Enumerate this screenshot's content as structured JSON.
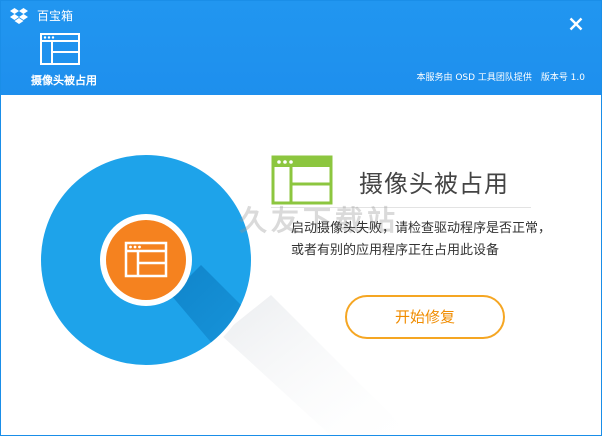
{
  "header": {
    "app_name": "百宝箱",
    "tab_label": "摄像头被占用",
    "provider": "本服务由 OSD 工具团队提供",
    "version": "版本号 1.0",
    "close_symbol": "✕"
  },
  "main": {
    "error_title": "摄像头被占用",
    "description_line1": "启动摄像头失败，请检查驱动程序是否正常，",
    "description_line2": "或者有别的应用程序正在占用此设备",
    "repair_button": "开始修复",
    "watermark": "久友下载站"
  },
  "colors": {
    "header_blue": "#1e8fed",
    "circle_blue": "#1ea3ea",
    "accent_orange": "#f5821f",
    "icon_green": "#8cc63f",
    "button_border": "#f5a623"
  },
  "icons": {
    "app_logo": "dropbox-box-icon",
    "tab": "window-icon",
    "title": "window-icon",
    "circle": "window-icon"
  }
}
